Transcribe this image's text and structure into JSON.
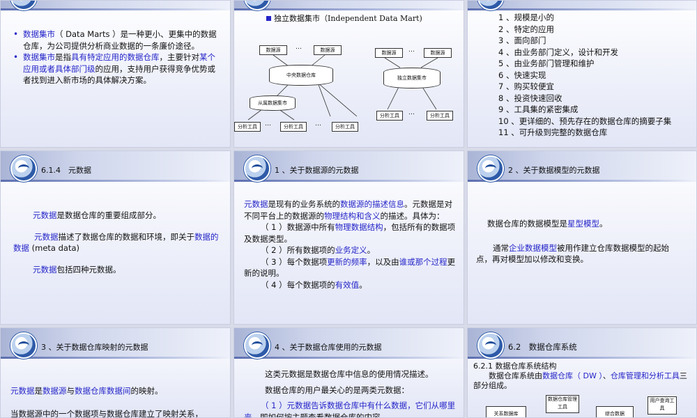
{
  "s1": {
    "bullets": [
      {
        "parts": [
          [
            "数据集市",
            "b"
          ],
          [
            "（ Data Marts ）是一种更小、更集中的数据仓库，为公司提供分析商业数据的一条廉价途径。",
            ""
          ]
        ]
      },
      {
        "parts": [
          [
            "数据集市",
            "b"
          ],
          [
            "是指",
            ""
          ],
          [
            "具有特定应用的数据仓库",
            "b"
          ],
          [
            "，主要针对",
            ""
          ],
          [
            "某个应用或者具体部门级",
            "b"
          ],
          [
            "的应用，支持用户获得竞争优势或者找到进入新市场的具体解决方案。",
            ""
          ]
        ]
      }
    ]
  },
  "s2": {
    "heading": "独立数据集市（Independent Data Mart)",
    "diagram": {
      "src1": "数据源",
      "src2": "数据源",
      "dots": "…",
      "central": "中央数据仓库",
      "dep_mart": "从属数据集市",
      "tool": "分析工具",
      "src3": "数据源",
      "src4": "数据源",
      "indep_mart": "独立数据集市",
      "tool2": "分析工具"
    }
  },
  "s3": {
    "items": [
      "1 、规模是小的",
      "2 、特定的应用",
      "3 、面向部门",
      "4 、由业务部门定义，设计和开发",
      "5 、由业务部门管理和维护",
      "6 、快速实现",
      "7 、购买较便宜",
      "8 、投资快速回收",
      "9 、工具集的紧密集成",
      "10 、更详细的、预先存在的数据仓库的摘要子集",
      "11 、可升级到完整的数据仓库"
    ]
  },
  "s4": {
    "title": "6.1.4　元数据",
    "p1": [
      [
        "元数据",
        "b"
      ],
      [
        "是数据仓库的重要组成部分。",
        ""
      ]
    ],
    "p2": [
      [
        "元数据",
        "b"
      ],
      [
        "描述了数据仓库的数据和环境，即关于",
        ""
      ],
      [
        "数据的数据",
        "b"
      ],
      [
        " (meta data)",
        ""
      ]
    ],
    "p3": [
      [
        "元数据",
        "b"
      ],
      [
        "包括四种元数据。",
        ""
      ]
    ]
  },
  "s5": {
    "title": "1 、关于数据源的元数据",
    "p1": [
      [
        "元数据",
        "b"
      ],
      [
        "是现有的业务系统的",
        ""
      ],
      [
        "数据源的描述信息",
        "b"
      ],
      [
        "。元数据是对不同平台上的数据源的",
        ""
      ],
      [
        "物理结构和含义",
        "b"
      ],
      [
        "的描述。具体为：",
        ""
      ]
    ],
    "p2": [
      [
        "（ 1 ）数据源中所有",
        ""
      ],
      [
        "物理数据结构",
        "b"
      ],
      [
        "，包括所有的数据项及数据类型。",
        ""
      ]
    ],
    "p3": [
      [
        "（ 2 ）所有数据项的",
        ""
      ],
      [
        "业务定义",
        "b"
      ],
      [
        "。",
        ""
      ]
    ],
    "p4": [
      [
        "（ 3 ）每个数据项",
        ""
      ],
      [
        "更新的频率",
        "b"
      ],
      [
        "，以及由",
        ""
      ],
      [
        "谁或那个过程",
        "b"
      ],
      [
        "更新的说明。",
        ""
      ]
    ],
    "p5": [
      [
        "（ 4 ）每个数据项的",
        ""
      ],
      [
        "有效值",
        "b"
      ],
      [
        "。",
        ""
      ]
    ]
  },
  "s6": {
    "title": "2 、关于数据模型的元数据",
    "p1": [
      [
        "数据仓库的数据模型是",
        ""
      ],
      [
        "星型模型",
        "b"
      ],
      [
        "。",
        ""
      ]
    ],
    "p2": [
      [
        "通常",
        ""
      ],
      [
        "企业数据模型",
        "b"
      ],
      [
        "被用作建立仓库数据模型的起始点，再对模型加以修改和变换。",
        ""
      ]
    ]
  },
  "s7": {
    "title": "3 、关于数据仓库映射的元数据",
    "p1": [
      [
        "元数据",
        "b"
      ],
      [
        "是",
        ""
      ],
      [
        "数据源",
        "b"
      ],
      [
        "与",
        ""
      ],
      [
        "数据仓库数据间",
        "b"
      ],
      [
        "的映射。",
        ""
      ]
    ],
    "p2": [
      [
        "当数据源中的一个数据项与数据仓库建立了映射关系，",
        ""
      ]
    ]
  },
  "s8": {
    "title": "4 、关于数据仓库使用的元数据",
    "p1": [
      [
        "这类元数据是数据仓库中信息的使用情况描述。",
        ""
      ]
    ],
    "p2": [
      [
        "数据仓库的用户最关心的是两类元数据：",
        ""
      ]
    ],
    "p3": [
      [
        "（ 1 ）元数据告诉数据仓库中有什么数据，它们从哪里来。",
        "b"
      ],
      [
        "即如何按主题查看数据仓库的内容。",
        ""
      ]
    ]
  },
  "s9": {
    "title": "6.2　数据仓库系统",
    "sub": "6.2.1 数据仓库系统结构",
    "p1": [
      [
        "数据仓库系统由",
        ""
      ],
      [
        "数据仓库（ DW ）",
        "b"
      ],
      [
        "、",
        ""
      ],
      [
        "仓库管理和分析工具",
        "b"
      ],
      [
        "三部分组成。",
        ""
      ]
    ],
    "diagram": {
      "n1": "数据仓库管理工具",
      "n2": "关系数据库",
      "n3": "综合数据",
      "n4": "用户查询工具"
    }
  }
}
